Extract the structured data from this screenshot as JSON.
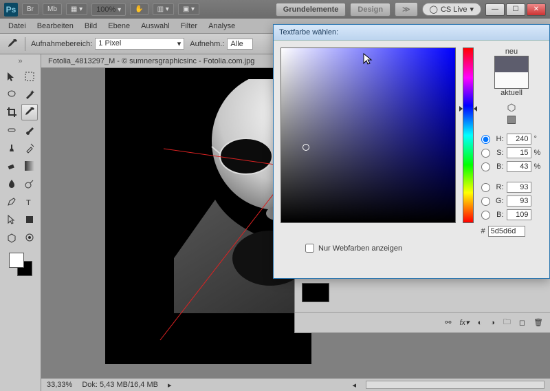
{
  "app": {
    "logo": "Ps",
    "br": "Br",
    "mb": "Mb",
    "zoom": "100%"
  },
  "workspace_btns": {
    "grund": "Grundelemente",
    "design": "Design",
    "cslive": "CS Live"
  },
  "menu": [
    "Datei",
    "Bearbeiten",
    "Bild",
    "Ebene",
    "Auswahl",
    "Filter",
    "Analyse"
  ],
  "options": {
    "range_label": "Aufnahmebereich:",
    "range_value": "1 Pixel",
    "mode_label": "Aufnehm.:",
    "mode_value": "Alle"
  },
  "doc": {
    "title": "Fotolia_4813297_M - © sumnersgraphicsinc - Fotolia.com.jpg"
  },
  "status": {
    "zoom": "33,33%",
    "doc": "Dok: 5,43 MB/16,4 MB"
  },
  "cp": {
    "title": "Textfarbe wählen:",
    "neu": "neu",
    "aktuell": "aktuell",
    "H": "H:",
    "S": "S:",
    "B": "B:",
    "R": "R:",
    "G": "G:",
    "Bb": "B:",
    "vH": "240",
    "vS": "15",
    "vB": "43",
    "vR": "93",
    "vG": "93",
    "vBb": "109",
    "deg": "°",
    "pct": "%",
    "hash": "#",
    "hex": "5d5d6d",
    "webonly": "Nur Webfarben anzeigen"
  }
}
